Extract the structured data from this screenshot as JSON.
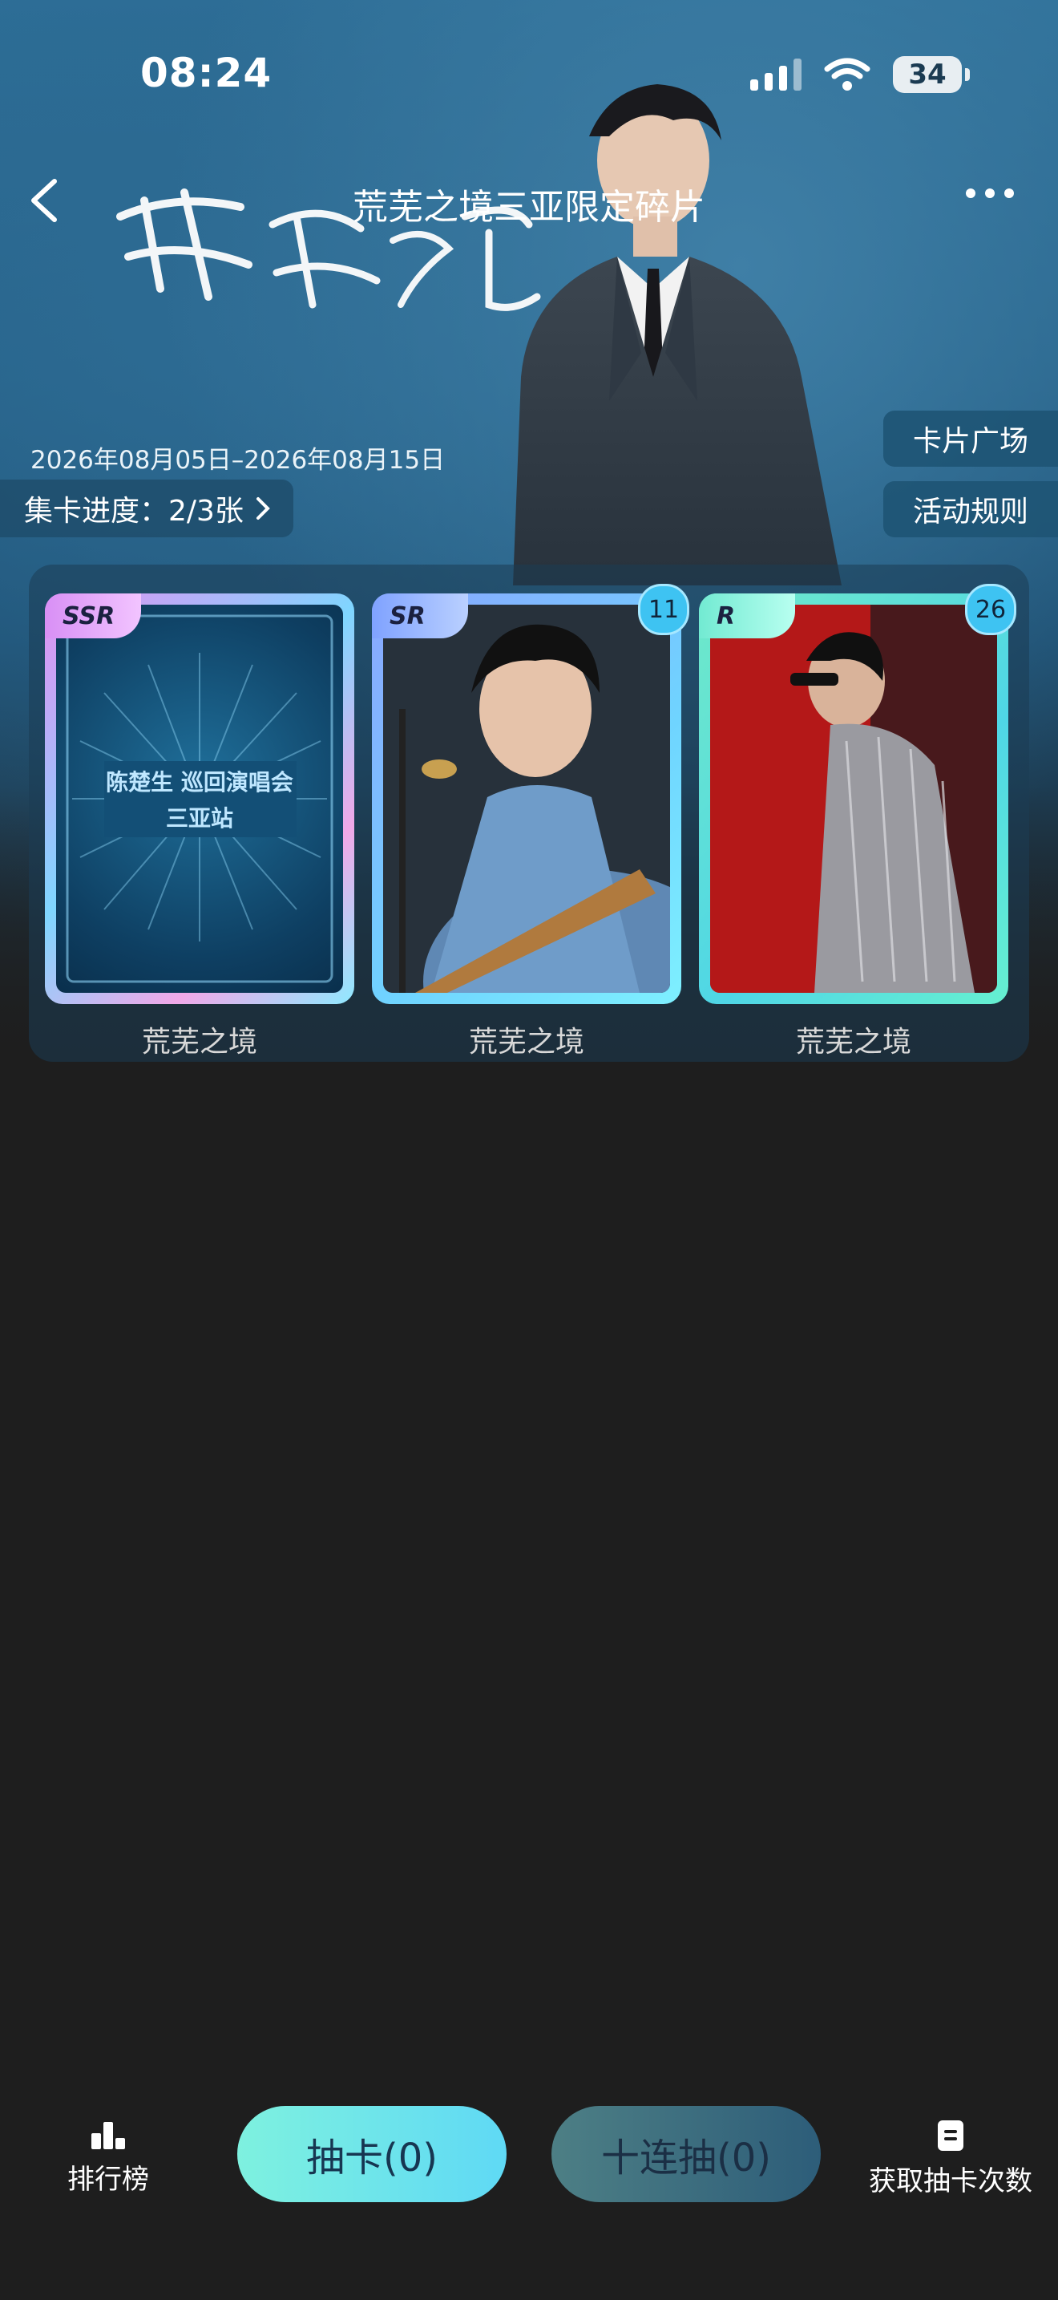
{
  "status_bar": {
    "time": "08:24",
    "battery": "34"
  },
  "nav": {
    "title": "荒芜之境三亚限定碎片"
  },
  "banner": {
    "date_range": "2026年08月05日–2026年08月15日",
    "progress_label": "集卡进度：2/3张",
    "card_square_button": "卡片广场",
    "rules_button": "活动规则"
  },
  "cards": [
    {
      "rarity": "SSR",
      "name": "荒芜之境",
      "count": "",
      "front_line1": "陈楚生 巡回演唱会",
      "front_line2": "三亚站"
    },
    {
      "rarity": "SR",
      "name": "荒芜之境",
      "count": "11"
    },
    {
      "rarity": "R",
      "name": "荒芜之境",
      "count": "26"
    }
  ],
  "bottom_bar": {
    "ranking_label": "排行榜",
    "draw_button": "抽卡(0)",
    "ten_draw_button": "十连抽(0)",
    "get_draws_label": "获取抽卡次数"
  },
  "colors": {
    "hero_blue": "#2d6f98",
    "page_bg": "#1e1e1e",
    "draw_gradient_start": "#7ef1df",
    "draw_gradient_end": "#5fd9f5"
  }
}
